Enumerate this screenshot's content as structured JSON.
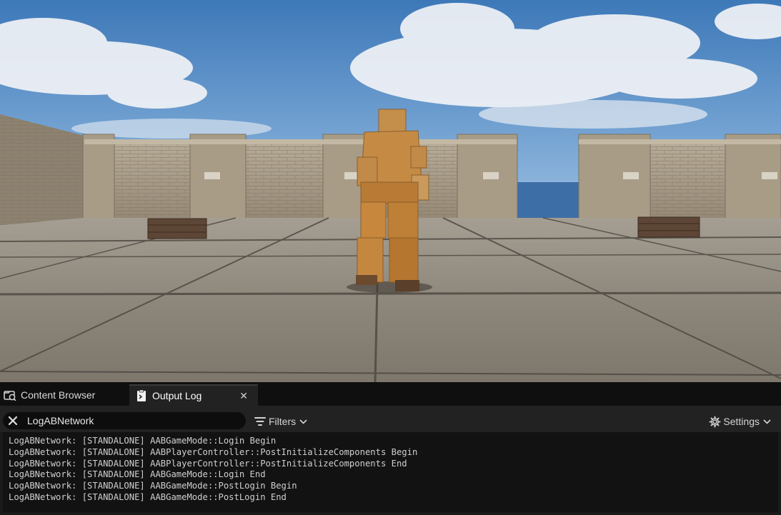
{
  "tabs": [
    {
      "label": "Content Browser",
      "icon": "content-browser-icon"
    },
    {
      "label": "Output Log",
      "icon": "output-log-icon",
      "active": true
    }
  ],
  "search": {
    "value": "LogABNetwork"
  },
  "toolbar": {
    "filters_label": "Filters",
    "settings_label": "Settings"
  },
  "log_lines": [
    "LogABNetwork: [STANDALONE] AABGameMode::Login Begin",
    "LogABNetwork: [STANDALONE] AABPlayerController::PostInitializeComponents Begin",
    "LogABNetwork: [STANDALONE] AABPlayerController::PostInitializeComponents End",
    "LogABNetwork: [STANDALONE] AABGameMode::Login End",
    "LogABNetwork: [STANDALONE] AABGameMode::PostLogin Begin",
    "LogABNetwork: [STANDALONE] AABGameMode::PostLogin End"
  ],
  "colors": {
    "panel_bg": "#1a1a1a",
    "tabbar_bg": "#0f0f0f",
    "log_bg": "#121212",
    "text": "#cfcfcf"
  }
}
